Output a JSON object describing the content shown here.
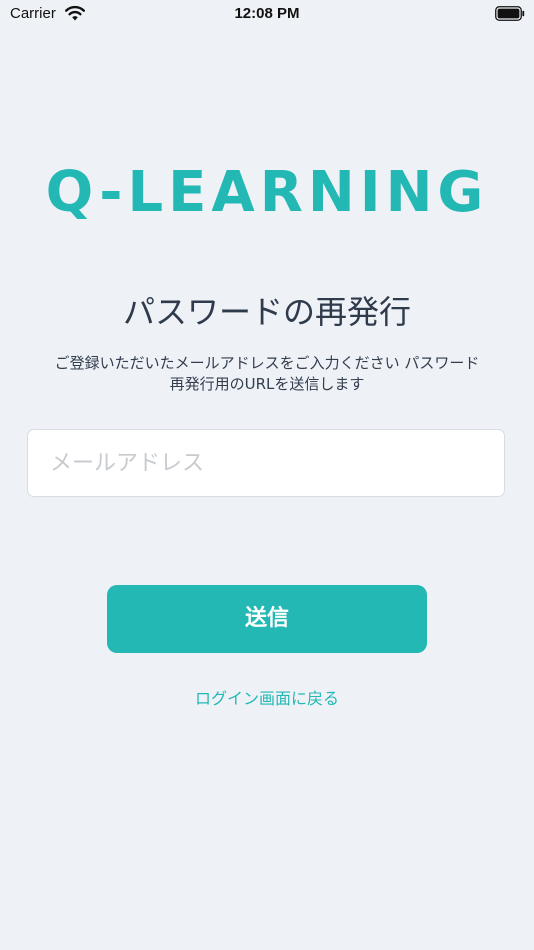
{
  "status_bar": {
    "carrier": "Carrier",
    "time": "12:08 PM"
  },
  "logo_text": "Q-LEARNING",
  "title": "パスワードの再発行",
  "description_line1": "ご登録いただいたメールアドレスをご入力ください パスワード",
  "description_line2": "再発行用のURLを送信します",
  "email": {
    "placeholder": "メールアドレス",
    "value": ""
  },
  "send_button_label": "送信",
  "back_link_label": "ログイン画面に戻る",
  "colors": {
    "accent": "#23b8b4",
    "background": "#eef2f7"
  },
  "icons": [
    "wifi-icon",
    "battery-icon"
  ]
}
